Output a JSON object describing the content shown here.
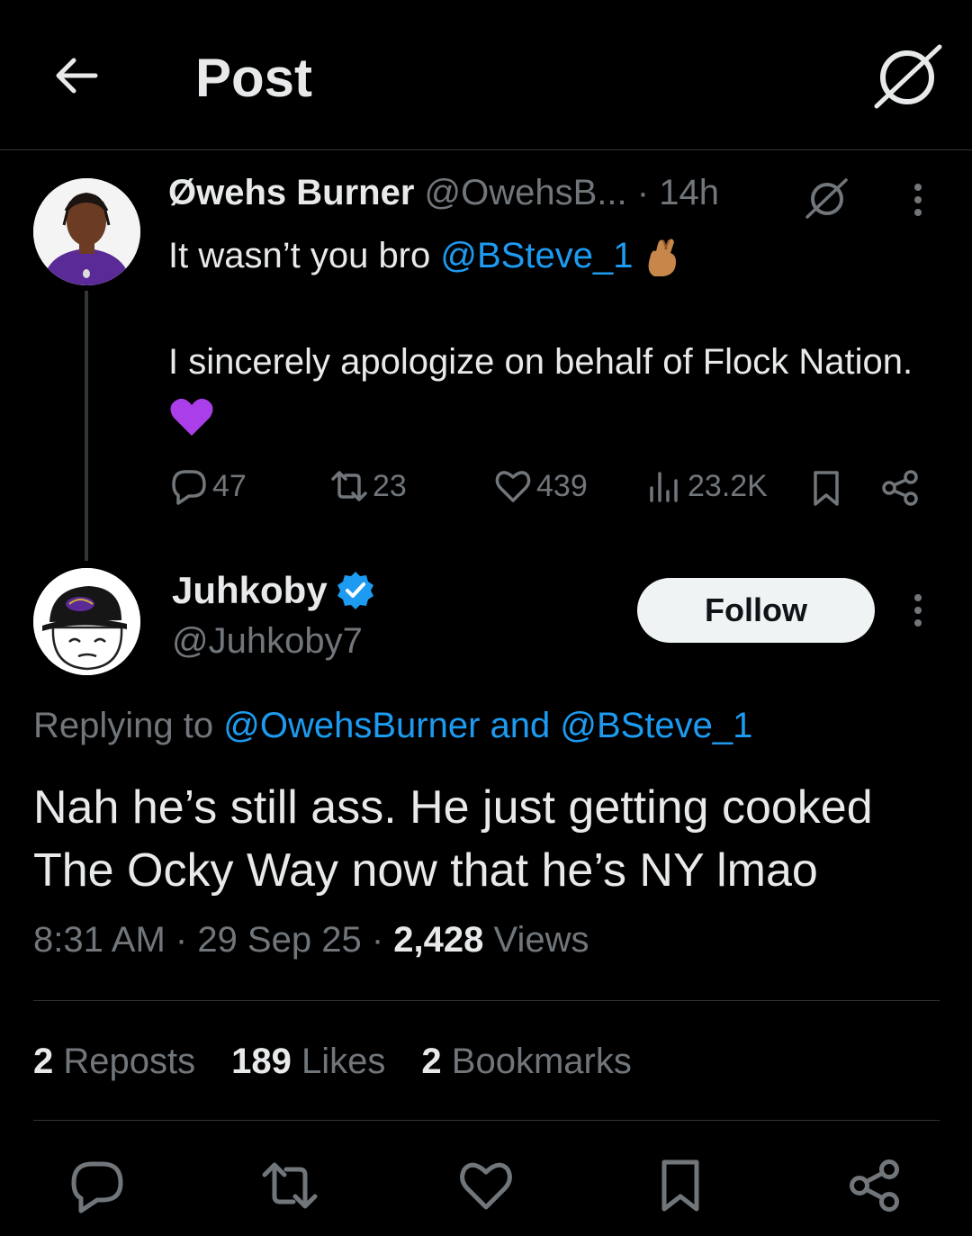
{
  "header": {
    "title": "Post"
  },
  "tweet1": {
    "name": "Øwehs Burner",
    "handle": "@OwehsB...",
    "time": "· 14h",
    "line1_text": "It wasn’t you bro ",
    "line1_mention": "@BSteve_1",
    "line2_text": "I sincerely apologize on behalf of Flock Nation.",
    "stats": {
      "replies": "47",
      "reposts": "23",
      "likes": "439",
      "views": "23.2K"
    }
  },
  "tweet2": {
    "name": "Juhkoby",
    "handle": "@Juhkoby7",
    "follow_label": "Follow",
    "replying_prefix": "Replying to ",
    "replying_mentions": "@OwehsBurner and @BSteve_1",
    "body": "Nah he’s still ass. He just getting cooked The Ocky Way now that he’s NY lmao",
    "time": "8:31 AM",
    "date": "29 Sep 25",
    "views_count": "2,428",
    "views_label": "Views",
    "reposts_count": "2",
    "reposts_label": "Reposts",
    "likes_count": "189",
    "likes_label": "Likes",
    "bookmarks_count": "2",
    "bookmarks_label": "Bookmarks"
  },
  "colors": {
    "accent": "#1d9bf0",
    "muted": "#71767b",
    "text": "#e7e9ea",
    "background": "#000000"
  },
  "icons": [
    "back-arrow-icon",
    "grok-slash-icon",
    "reply-icon",
    "repost-icon",
    "like-icon",
    "views-icon",
    "bookmark-icon",
    "share-icon",
    "more-icon",
    "verified-icon"
  ]
}
